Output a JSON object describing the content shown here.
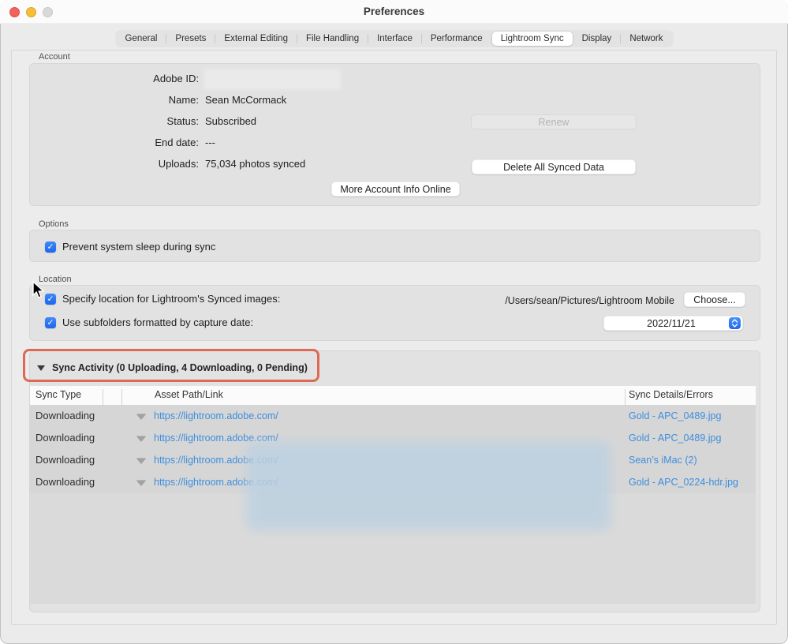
{
  "window": {
    "title": "Preferences"
  },
  "tabs": {
    "items": [
      "General",
      "Presets",
      "External Editing",
      "File Handling",
      "Interface",
      "Performance",
      "Lightroom Sync",
      "Display",
      "Network"
    ],
    "selected": "Lightroom Sync"
  },
  "account": {
    "section_label": "Account",
    "fields": [
      {
        "label": "Adobe ID:",
        "value": "",
        "redacted": true
      },
      {
        "label": "Name:",
        "value": "Sean McCormack"
      },
      {
        "label": "Status:",
        "value": "Subscribed"
      },
      {
        "label": "End date:",
        "value": "---"
      },
      {
        "label": "Uploads:",
        "value": "75,034 photos synced"
      }
    ],
    "renew_label": "Renew",
    "delete_label": "Delete All Synced Data",
    "more_info_label": "More Account Info Online"
  },
  "options": {
    "section_label": "Options",
    "sleep_checkbox_label": "Prevent system sleep during sync",
    "sleep_checked": true
  },
  "location": {
    "section_label": "Location",
    "specify_checkbox_label": "Specify location for Lightroom's Synced images:",
    "specify_checked": true,
    "path": "/Users/sean/Pictures/Lightroom Mobile",
    "choose_label": "Choose...",
    "subfolders_checkbox_label": "Use subfolders formatted by capture date:",
    "subfolders_checked": true,
    "date_format_value": "2022/11/21"
  },
  "sync": {
    "header_label": "Sync Activity  (0 Uploading, 4 Downloading, 0 Pending)",
    "columns": [
      "Sync Type",
      "Asset Path/Link",
      "Sync Details/Errors"
    ],
    "rows": [
      {
        "type": "Downloading",
        "link": "https://lightroom.adobe.com/",
        "details": "Gold - APC_0489.jpg"
      },
      {
        "type": "Downloading",
        "link": "https://lightroom.adobe.com/",
        "details": "Gold - APC_0489.jpg"
      },
      {
        "type": "Downloading",
        "link": "https://lightroom.adobe.com/",
        "details": "Sean’s iMac (2)"
      },
      {
        "type": "Downloading",
        "link": "https://lightroom.adobe.com/",
        "details": "Gold - APC_0224-hdr.jpg"
      }
    ]
  },
  "glyphs": {
    "check": "✓"
  },
  "colors": {
    "accent_blue": "#2268ef",
    "link_blue": "#3e8edd",
    "annotation_red": "#dc6a55",
    "traffic_red": "#f4605a",
    "traffic_yellow": "#f6bd37",
    "traffic_gray": "#d9d9d9"
  }
}
